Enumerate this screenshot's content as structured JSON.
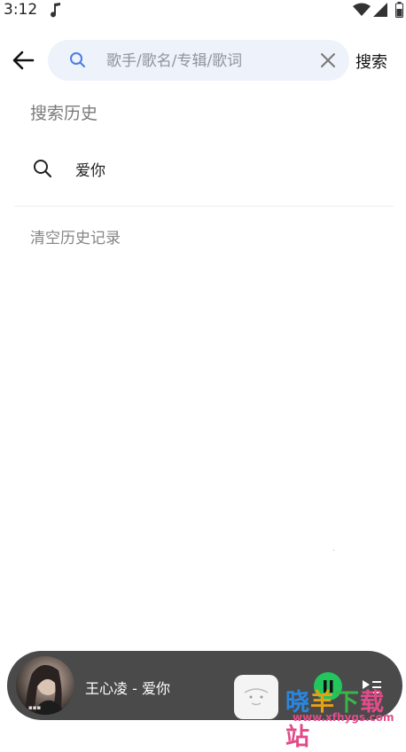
{
  "status_bar": {
    "time": "3:12"
  },
  "search": {
    "placeholder": "歌手/歌名/专辑/歌词",
    "value": "",
    "submit_label": "搜索"
  },
  "history": {
    "heading": "搜索历史",
    "items": [
      {
        "label": "爱你"
      }
    ],
    "clear_label": "清空历史记录"
  },
  "player": {
    "now_playing": "王心凌 - 爱你",
    "state": "playing"
  },
  "watermark": {
    "text": "晓羊下载站",
    "url": "www.xfhygs.com"
  },
  "colors": {
    "accent": "#22c55e",
    "search_bg": "#eef2fb",
    "player_bg": "#4a4a4a"
  }
}
